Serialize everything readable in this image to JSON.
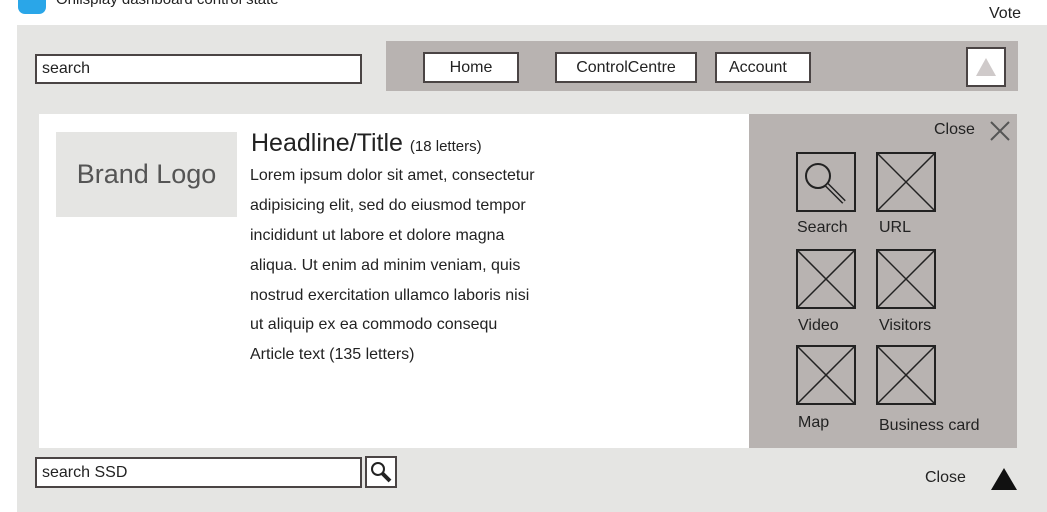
{
  "top": {
    "caption": "Onlisplay dashboard control state",
    "vote_label": "Vote"
  },
  "search": {
    "value": "search"
  },
  "nav": {
    "items": [
      {
        "label": "Home"
      },
      {
        "label": "ControlCentre"
      },
      {
        "label": "Account"
      }
    ],
    "up_icon": "triangle-up-icon"
  },
  "brand": {
    "label": "Brand Logo"
  },
  "article": {
    "headline": "Headline/Title",
    "headline_note": "(18 letters)",
    "lines": [
      "Lorem ipsum dolor sit amet, consectetur",
      "adipisicing elit, sed do eiusmod tempor",
      "incididunt ut labore et dolore magna",
      "aliqua. Ut enim ad minim veniam, quis",
      "nostrud exercitation ullamco laboris nisi",
      "ut aliquip ex ea commodo consequ",
      "Article text (135 letters)"
    ]
  },
  "panel": {
    "close_label": "Close",
    "tiles": [
      {
        "label": "Search",
        "icon": "magnifier-icon"
      },
      {
        "label": "URL",
        "icon": "placeholder-x-icon"
      },
      {
        "label": "Video",
        "icon": "placeholder-x-icon"
      },
      {
        "label": "Visitors",
        "icon": "placeholder-x-icon"
      },
      {
        "label": "Map",
        "icon": "placeholder-x-icon"
      },
      {
        "label": "Business card",
        "icon": "placeholder-x-icon"
      }
    ]
  },
  "bottom": {
    "search_value": "search SSD",
    "close_label": "Close"
  },
  "colors": {
    "frame_bg": "#e5e5e3",
    "bar_bg": "#b8b3b1",
    "border": "#4a4444",
    "badge": "#2aa6e8"
  }
}
